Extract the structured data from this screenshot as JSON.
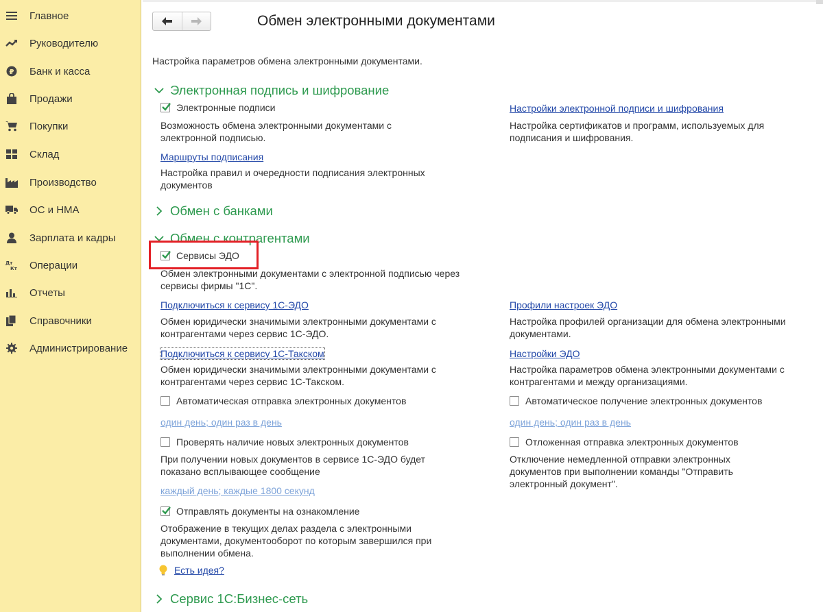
{
  "sidebar": {
    "items": [
      {
        "label": "Главное",
        "icon": "menu-icon"
      },
      {
        "label": "Руководителю",
        "icon": "trend-icon"
      },
      {
        "label": "Банк и касса",
        "icon": "ruble-coin-icon"
      },
      {
        "label": "Продажи",
        "icon": "shopping-bag-icon"
      },
      {
        "label": "Покупки",
        "icon": "cart-icon"
      },
      {
        "label": "Склад",
        "icon": "warehouse-grid-icon"
      },
      {
        "label": "Производство",
        "icon": "factory-icon"
      },
      {
        "label": "ОС и НМА",
        "icon": "truck-icon"
      },
      {
        "label": "Зарплата и кадры",
        "icon": "person-icon"
      },
      {
        "label": "Операции",
        "icon": "debit-credit-icon"
      },
      {
        "label": "Отчеты",
        "icon": "bar-chart-icon"
      },
      {
        "label": "Справочники",
        "icon": "books-icon"
      },
      {
        "label": "Администрирование",
        "icon": "gear-icon"
      }
    ]
  },
  "header": {
    "title": "Обмен электронными документами",
    "subtitle": "Настройка параметров обмена электронными документами."
  },
  "sections": {
    "signature": {
      "title": "Электронная подпись и шифрование",
      "cb_label": "Электронные подписи",
      "cb_checked": true,
      "cb_desc": "Возможность обмена электронными документами с электронной подписью.",
      "settings_link": "Настройки электронной подписи и шифрования",
      "settings_desc": "Настройка сертификатов и программ, используемых для подписания и шифрования.",
      "routes_link": "Маршруты подписания",
      "routes_desc": "Настройка правил и очередности подписания электронных документов"
    },
    "banks": {
      "title": "Обмен с банками"
    },
    "counterparties": {
      "title": "Обмен с контрагентами",
      "edo_cb_label": "Сервисы ЭДО",
      "edo_cb_checked": true,
      "edo_desc": "Обмен электронными документами с электронной подписью через сервисы фирмы \"1С\".",
      "connect_edo_link": "Подключиться к сервису 1С-ЭДО",
      "connect_edo_desc": "Обмен юридически значимыми электронными документами с контрагентами через сервис 1С-ЭДО.",
      "profiles_link": "Профили настроек ЭДО",
      "profiles_desc": "Настройка профилей организации для обмена электронными документами.",
      "connect_taxcom_link": "Подключиться к сервису 1С-Такском",
      "connect_taxcom_desc": "Обмен юридически значимыми электронными документами с контрагентами через сервис 1С-Такском.",
      "edo_settings_link": "Настройки ЭДО",
      "edo_settings_desc": "Настройка параметров обмена электронными документами с контрагентами и между организациями.",
      "auto_send_label": "Автоматическая отправка электронных документов",
      "auto_send_checked": false,
      "auto_send_schedule": "один день; один раз в день",
      "auto_receive_label": "Автоматическое получение электронных документов",
      "auto_receive_checked": false,
      "auto_receive_schedule": "один день; один раз в день",
      "check_new_label": "Проверять наличие новых электронных документов",
      "check_new_checked": false,
      "check_new_desc": "При получении новых документов в сервисе 1С-ЭДО будет показано всплывающее сообщение",
      "check_new_schedule": "каждый день; каждые 1800 секунд",
      "deferred_label": "Отложенная отправка электронных документов",
      "deferred_checked": false,
      "deferred_desc": "Отключение немедленной отправки электронных документов при выполнении команды \"Отправить электронный документ\".",
      "review_label": "Отправлять документы на ознакомление",
      "review_checked": true,
      "review_desc": "Отображение в текущих делах  раздела с электронными документами, документооборот по которым завершился при выполнении обмена.",
      "idea_link": "Есть идея?"
    },
    "business_network": {
      "title": "Сервис 1С:Бизнес-сеть"
    }
  },
  "colors": {
    "sidebar_bg": "#fbeda7",
    "section_green": "#2e9a4f",
    "link_blue": "#2348a8",
    "muted_link": "#7da3d9",
    "highlight_red": "#e32026",
    "check_green": "#2e9a4f"
  }
}
